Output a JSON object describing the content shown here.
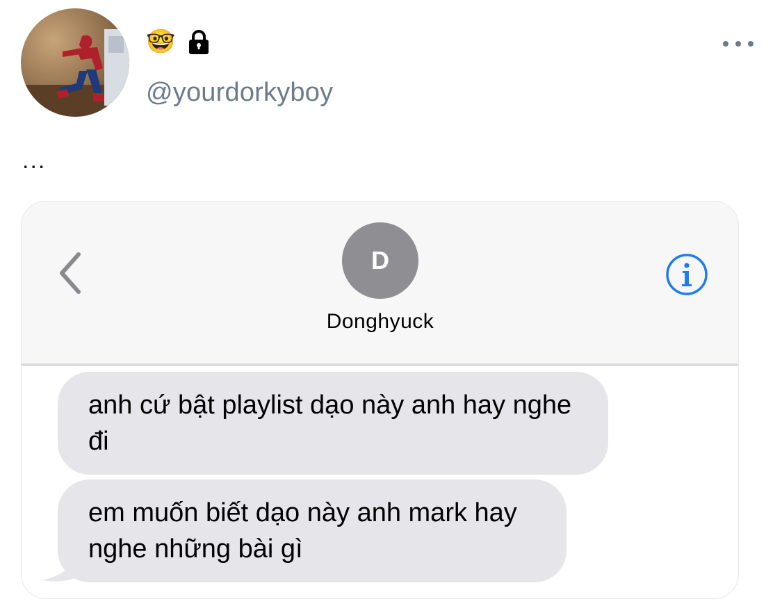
{
  "profile": {
    "avatar_icon": "spider-man-figure-avatar",
    "name_emoji": "🤓",
    "lock_icon": "lock-icon",
    "handle": "@yourdorkyboy",
    "more_icon": "more-horizontal-icon"
  },
  "tweet": {
    "text": "..."
  },
  "conversation": {
    "back_icon": "chevron-left-icon",
    "contact_initial": "D",
    "contact_name": "Donghyuck",
    "info_icon": "info-icon",
    "messages": [
      {
        "text": "anh cứ bật playlist dạo này anh hay nghe đi"
      },
      {
        "text": "em muốn biết dạo này anh mark hay nghe những bài gì"
      }
    ]
  },
  "colors": {
    "handle": "#6b7b8b",
    "ios_blue": "#1e7cf0",
    "bubble_gray": "#e5e5ea",
    "contact_avatar_gray": "#8e8e93"
  }
}
